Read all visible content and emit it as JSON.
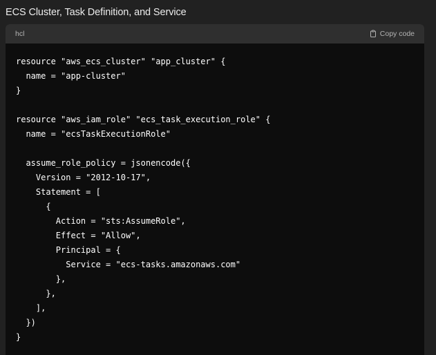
{
  "heading": "ECS Cluster, Task Definition, and Service",
  "code_block": {
    "language": "hcl",
    "copy_label": "Copy code",
    "copy_icon": "clipboard-icon",
    "lines": [
      "resource \"aws_ecs_cluster\" \"app_cluster\" {",
      "  name = \"app-cluster\"",
      "}",
      "",
      "resource \"aws_iam_role\" \"ecs_task_execution_role\" {",
      "  name = \"ecsTaskExecutionRole\"",
      "",
      "  assume_role_policy = jsonencode({",
      "    Version = \"2012-10-17\",",
      "    Statement = [",
      "      {",
      "        Action = \"sts:AssumeRole\",",
      "        Effect = \"Allow\",",
      "        Principal = {",
      "          Service = \"ecs-tasks.amazonaws.com\"",
      "        },",
      "      },",
      "    ],",
      "  })",
      "}"
    ]
  },
  "colors": {
    "page_background": "#212121",
    "code_background": "#0d0d0d",
    "code_header_background": "#2f2f2f",
    "code_text": "#ffffff",
    "muted_text": "#b4b4b4"
  }
}
